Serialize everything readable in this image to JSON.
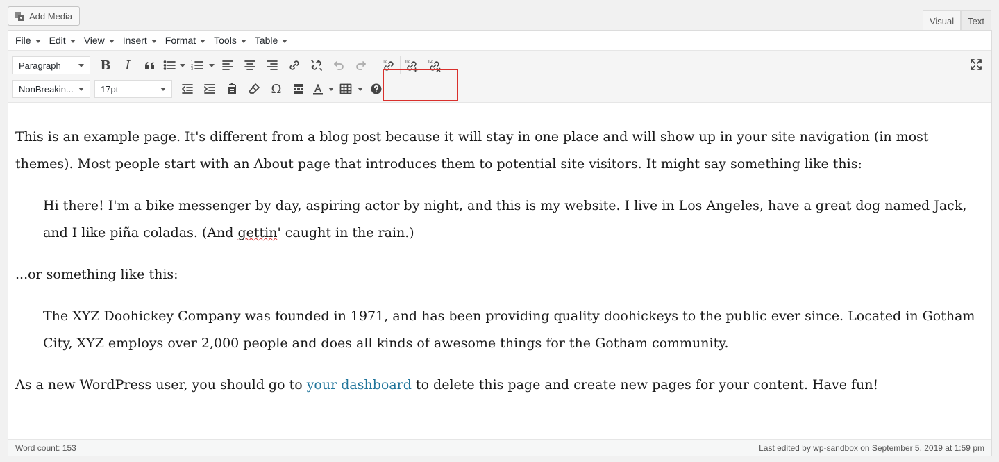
{
  "add_media": {
    "label": "Add Media"
  },
  "tabs": [
    {
      "label": "Visual",
      "active": true
    },
    {
      "label": "Text",
      "active": false
    }
  ],
  "menubar": {
    "items": [
      "File",
      "Edit",
      "View",
      "Insert",
      "Format",
      "Tools",
      "Table"
    ]
  },
  "toolbar": {
    "format_select": "Paragraph",
    "font_select": "NonBreakin...",
    "size_select": "17pt"
  },
  "content": {
    "p1": "This is an example page. It's different from a blog post because it will stay in one place and will show up in your site navigation (in most themes). Most people start with an About page that introduces them to potential site visitors. It might say something like this:",
    "quote1_before": "Hi there! I'm a bike messenger by day, aspiring actor by night, and this is my website. I live in Los Angeles, have a great dog named Jack, and I like piña coladas. (And ",
    "quote1_spell": "gettin",
    "quote1_after": "' caught in the rain.)",
    "p2": "...or something like this:",
    "quote2": "The XYZ Doohickey Company was founded in 1971, and has been providing quality doohickeys to the public ever since. Located in Gotham City, XYZ employs over 2,000 people and does all kinds of awesome things for the Gotham community.",
    "p3_before": "As a new WordPress user, you should go to ",
    "p3_link": "your dashboard",
    "p3_after": " to delete this page and create new pages for your content. Have fun!"
  },
  "status": {
    "word_count": "Word count: 153",
    "last_edited": "Last edited by wp-sandbox on September 5, 2019 at 1:59 pm"
  },
  "colors": {
    "highlight_box": "#d9302c",
    "link": "#21759b"
  }
}
